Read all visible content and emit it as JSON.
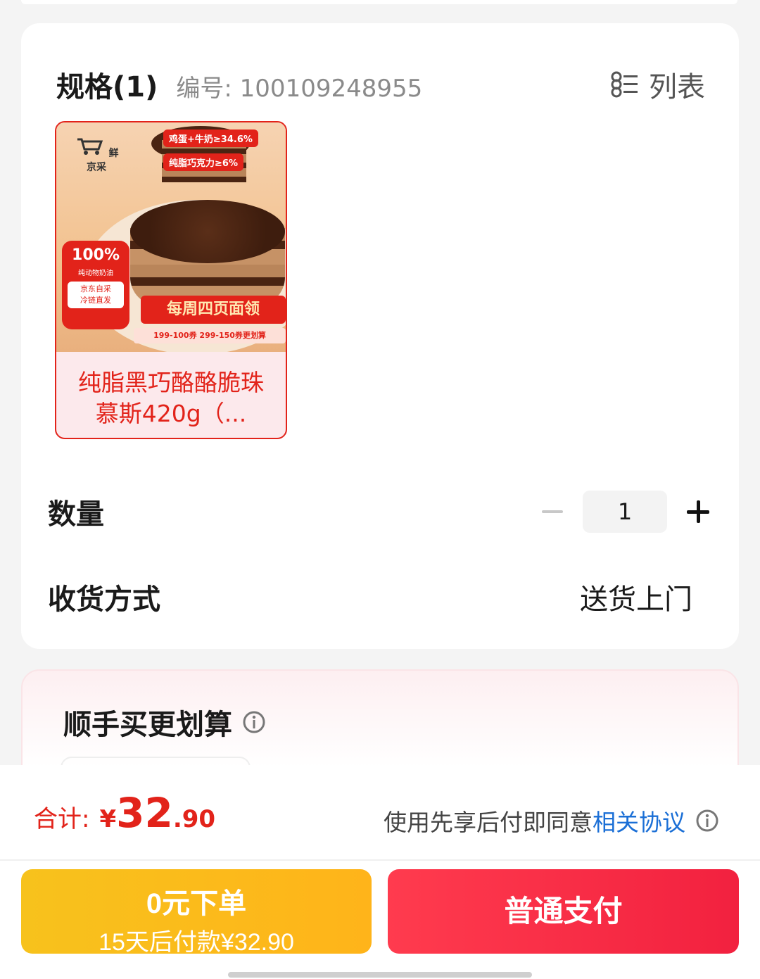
{
  "spec": {
    "title": "规格(1)",
    "number_label": "编号: 100109248955",
    "view_toggle_label": "列表"
  },
  "product": {
    "name_line1": "纯脂黑巧酪酪脆珠",
    "name_line2": "慕斯420g（...",
    "image": {
      "brand": "鲜京采",
      "tag_1": "鸡蛋+牛奶≥34.6%",
      "tag_2": "纯脂巧克力≥6%",
      "badge_big": "100%",
      "badge_small": "纯动物奶油",
      "badge_box_1": "京东自采",
      "badge_box_2": "冷链直发",
      "weekly": "每周四页面领",
      "coupon": "199-100券 299-150券更划算"
    }
  },
  "quantity": {
    "label": "数量",
    "value": "1"
  },
  "delivery": {
    "label": "收货方式",
    "value": "送货上门"
  },
  "addon": {
    "title": "顺手买更划算"
  },
  "footer": {
    "total_label": "合计:",
    "currency": "¥",
    "total_integer": "32",
    "total_decimal": ".90",
    "agreement_prefix": "使用先享后付即同意",
    "agreement_link": "相关协议",
    "pay_later_line1": "0元下单",
    "pay_later_line2": "15天后付款¥32.90",
    "pay_button": "普通支付"
  },
  "colors": {
    "accent_red": "#e2231a",
    "link_blue": "#1b6fd6",
    "pay_later_yellow": "#f7c21c",
    "pay_red": "#f2213f"
  }
}
